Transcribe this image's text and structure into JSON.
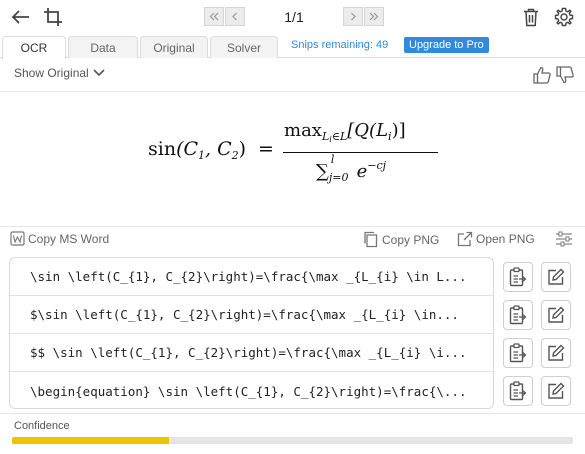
{
  "pager": {
    "page": "1/1"
  },
  "tabs": [
    {
      "label": "OCR",
      "active": true
    },
    {
      "label": "Data",
      "active": false
    },
    {
      "label": "Original",
      "active": false
    },
    {
      "label": "Solver",
      "active": false
    }
  ],
  "snips_remaining": "Snips remaining: 49",
  "upgrade_label": "Upgrade to Pro",
  "show_original": "Show Original",
  "formula": {
    "lhs_func": "sin",
    "lhs_args": "(C",
    "arg1_sub": "1",
    "arg_sep": ", C",
    "arg2_sub": "2",
    "arg_close": ")",
    "equals": "=",
    "num_op": "max",
    "num_sub": "L",
    "num_sub2": "i",
    "num_sub3": "∈L",
    "num_body": "[Q(L",
    "num_body_sub": "i",
    "num_body_close": ")]",
    "den_sum": "∑",
    "den_sub": "j=0",
    "den_sup": "l",
    "den_base": "e",
    "den_exp": "−cj"
  },
  "actions": {
    "copy_ms_word": "Copy MS Word",
    "copy_png": "Copy PNG",
    "open_png": "Open PNG"
  },
  "results": [
    "\\sin \\left(C_{1}, C_{2}\\right)=\\frac{\\max _{L_{i} \\in L...",
    "$\\sin \\left(C_{1}, C_{2}\\right)=\\frac{\\max _{L_{i} \\in...",
    "$$ \\sin \\left(C_{1}, C_{2}\\right)=\\frac{\\max _{L_{i} \\i...",
    "\\begin{equation} \\sin \\left(C_{1}, C_{2}\\right)=\\frac{\\..."
  ],
  "confidence": {
    "label": "Confidence",
    "value": 0.28,
    "color": "#f2c200"
  },
  "colors": {
    "accent": "#2f8ae0"
  }
}
